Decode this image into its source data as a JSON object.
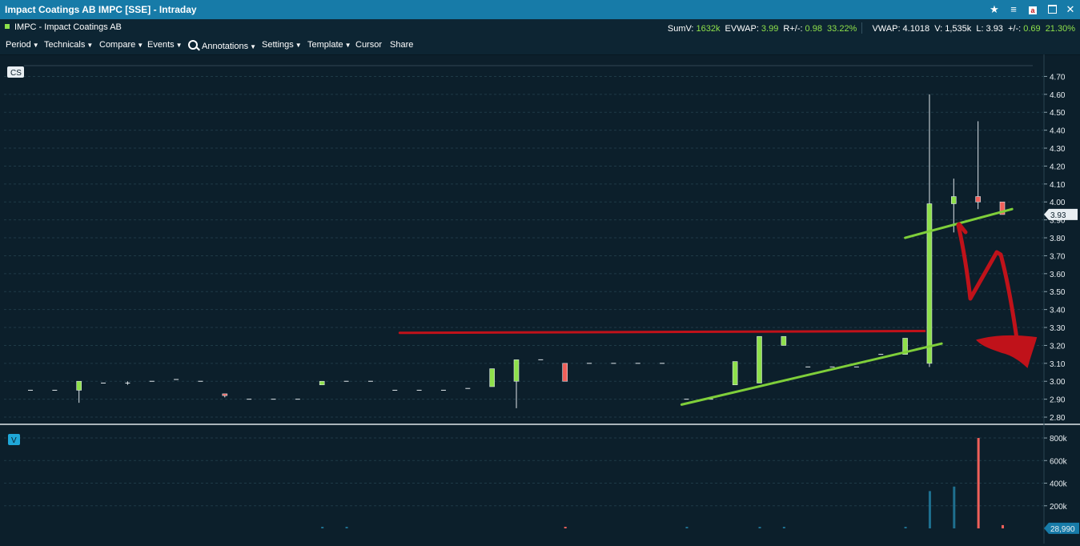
{
  "window": {
    "title": "Impact Coatings AB IMPC [SSE] - Intraday",
    "icons": [
      "star-icon",
      "list-icon",
      "close-box-icon",
      "maximize-icon",
      "close-icon"
    ]
  },
  "info": {
    "symbol": "IMPC - Impact Coatings AB",
    "sumv_label": "SumV:",
    "sumv_value": "1632k",
    "evwap_label": "EVWAP:",
    "evwap_value": "3.99",
    "rpm_label": "R+/-:",
    "rpm_value": "0.98",
    "rpm_pct": "33.22%",
    "vwap_label": "VWAP:",
    "vwap_value": "4.1018",
    "v_label": "V:",
    "v_value": "1,535k",
    "l_label": "L:",
    "l_value": "3.93",
    "pm_label": "+/-:",
    "pm_value": "0.69",
    "pm_pct": "21.30%"
  },
  "menu": [
    "Period",
    "Technicals",
    "Compare",
    "Events",
    "Annotations",
    "Settings",
    "Template",
    "Cursor",
    "Share"
  ],
  "chart_data": [
    {
      "type": "candlestick",
      "badge": "CS",
      "y_ticks": [
        4.7,
        4.6,
        4.5,
        4.4,
        4.3,
        4.2,
        4.1,
        4.0,
        3.9,
        3.8,
        3.7,
        3.6,
        3.5,
        3.4,
        3.3,
        3.2,
        3.1,
        3.0,
        2.9,
        2.8
      ],
      "ylim": [
        2.76,
        4.76
      ],
      "last_price_label": "3.93",
      "grid": true,
      "colors": {
        "up": "#8ee04a",
        "down": "#f0605a",
        "doji": "#dfe6ea",
        "trend_green": "#7fcf3a",
        "resistance": "#c0121a",
        "arrow": "#c0121a"
      },
      "candles": [
        {
          "o": 2.95,
          "h": 2.95,
          "l": 2.95,
          "c": 2.95
        },
        {
          "o": 2.95,
          "h": 2.95,
          "l": 2.95,
          "c": 2.95
        },
        {
          "o": 2.95,
          "h": 3.0,
          "l": 2.88,
          "c": 3.0
        },
        {
          "o": 2.99,
          "h": 2.99,
          "l": 2.99,
          "c": 2.99
        },
        {
          "o": 2.99,
          "h": 3.0,
          "l": 2.98,
          "c": 2.99
        },
        {
          "o": 3.0,
          "h": 3.0,
          "l": 3.0,
          "c": 3.0
        },
        {
          "o": 3.01,
          "h": 3.01,
          "l": 3.01,
          "c": 3.01
        },
        {
          "o": 3.0,
          "h": 3.0,
          "l": 3.0,
          "c": 3.0
        },
        {
          "o": 2.93,
          "h": 2.93,
          "l": 2.91,
          "c": 2.92
        },
        {
          "o": 2.9,
          "h": 2.9,
          "l": 2.9,
          "c": 2.9
        },
        {
          "o": 2.9,
          "h": 2.9,
          "l": 2.9,
          "c": 2.9
        },
        {
          "o": 2.9,
          "h": 2.9,
          "l": 2.9,
          "c": 2.9
        },
        {
          "o": 2.98,
          "h": 3.0,
          "l": 2.98,
          "c": 3.0
        },
        {
          "o": 3.0,
          "h": 3.0,
          "l": 3.0,
          "c": 3.0
        },
        {
          "o": 3.0,
          "h": 3.0,
          "l": 3.0,
          "c": 3.0
        },
        {
          "o": 2.95,
          "h": 2.95,
          "l": 2.95,
          "c": 2.95
        },
        {
          "o": 2.95,
          "h": 2.95,
          "l": 2.95,
          "c": 2.95
        },
        {
          "o": 2.95,
          "h": 2.95,
          "l": 2.95,
          "c": 2.95
        },
        {
          "o": 2.96,
          "h": 2.96,
          "l": 2.96,
          "c": 2.96
        },
        {
          "o": 2.97,
          "h": 3.07,
          "l": 2.97,
          "c": 3.07
        },
        {
          "o": 3.0,
          "h": 3.12,
          "l": 2.85,
          "c": 3.12
        },
        {
          "o": 3.12,
          "h": 3.12,
          "l": 3.12,
          "c": 3.12
        },
        {
          "o": 3.1,
          "h": 3.1,
          "l": 3.0,
          "c": 3.0
        },
        {
          "o": 3.1,
          "h": 3.1,
          "l": 3.1,
          "c": 3.1
        },
        {
          "o": 3.1,
          "h": 3.1,
          "l": 3.1,
          "c": 3.1
        },
        {
          "o": 3.1,
          "h": 3.1,
          "l": 3.1,
          "c": 3.1
        },
        {
          "o": 3.1,
          "h": 3.1,
          "l": 3.1,
          "c": 3.1
        },
        {
          "o": 2.9,
          "h": 2.9,
          "l": 2.9,
          "c": 2.9
        },
        {
          "o": 2.9,
          "h": 2.9,
          "l": 2.9,
          "c": 2.9
        },
        {
          "o": 2.98,
          "h": 3.11,
          "l": 2.98,
          "c": 3.11
        },
        {
          "o": 2.99,
          "h": 3.25,
          "l": 2.99,
          "c": 3.25
        },
        {
          "o": 3.2,
          "h": 3.25,
          "l": 3.2,
          "c": 3.25
        },
        {
          "o": 3.08,
          "h": 3.08,
          "l": 3.08,
          "c": 3.08
        },
        {
          "o": 3.08,
          "h": 3.08,
          "l": 3.08,
          "c": 3.08
        },
        {
          "o": 3.08,
          "h": 3.08,
          "l": 3.08,
          "c": 3.08
        },
        {
          "o": 3.15,
          "h": 3.15,
          "l": 3.15,
          "c": 3.15
        },
        {
          "o": 3.15,
          "h": 3.24,
          "l": 3.15,
          "c": 3.24
        },
        {
          "o": 3.1,
          "h": 4.6,
          "l": 3.08,
          "c": 3.99
        },
        {
          "o": 3.99,
          "h": 4.13,
          "l": 3.83,
          "c": 4.03
        },
        {
          "o": 4.03,
          "h": 4.45,
          "l": 3.96,
          "c": 4.0
        },
        {
          "o": 4.0,
          "h": 4.0,
          "l": 3.93,
          "c": 3.93
        }
      ],
      "annotations": {
        "resistance_line": [
          [
            15.2,
            3.27
          ],
          [
            36.8,
            3.28
          ]
        ],
        "support_line_1": [
          [
            26.8,
            2.87
          ],
          [
            37.5,
            3.21
          ]
        ],
        "support_line_2": [
          [
            36.0,
            3.8
          ],
          [
            40.4,
            3.96
          ]
        ]
      }
    },
    {
      "type": "bar",
      "badge": "V",
      "y_ticks": [
        "800k",
        "600k",
        "400k",
        "200k"
      ],
      "tick_values": [
        800000,
        600000,
        400000,
        200000
      ],
      "ylim": [
        0,
        850000
      ],
      "last_volume_label": "28,990",
      "colors": {
        "up": "#1e6f8f",
        "down": "#f0605a"
      },
      "values": [
        0,
        0,
        0,
        0,
        0,
        0,
        0,
        0,
        0,
        0,
        0,
        0,
        5000,
        5000,
        0,
        0,
        0,
        0,
        0,
        0,
        0,
        0,
        8000,
        0,
        0,
        0,
        0,
        5000,
        0,
        0,
        5000,
        5000,
        0,
        0,
        0,
        0,
        10000,
        330000,
        370000,
        800000,
        28990
      ],
      "directions": [
        "u",
        "u",
        "u",
        "u",
        "u",
        "u",
        "u",
        "u",
        "d",
        "u",
        "u",
        "u",
        "u",
        "u",
        "u",
        "u",
        "u",
        "u",
        "u",
        "u",
        "u",
        "u",
        "d",
        "u",
        "u",
        "u",
        "u",
        "u",
        "u",
        "u",
        "u",
        "u",
        "u",
        "u",
        "u",
        "u",
        "u",
        "u",
        "u",
        "d",
        "d"
      ]
    }
  ]
}
